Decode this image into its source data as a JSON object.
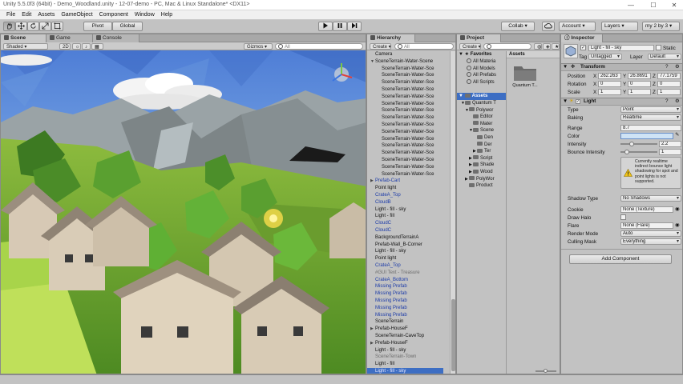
{
  "window": {
    "title": "Unity 5.5.0f3 (64bit) - Demo_Woodland.unity - 12-07-demo - PC, Mac & Linux Standalone* <DX11>",
    "controls": {
      "minimize": "—",
      "maximize": "☐",
      "close": "✕"
    }
  },
  "menu": [
    "File",
    "Edit",
    "Assets",
    "GameObject",
    "Component",
    "Window",
    "Help"
  ],
  "toolbar": {
    "pivot_label": "Pivot",
    "global_label": "Global",
    "collab_label": "Collab ▾",
    "account_label": "Account",
    "layers_label": "Layers",
    "layout_label": "my 2 by 3"
  },
  "scene_panel": {
    "tabs": [
      "Scene",
      "Game",
      "Console"
    ],
    "shading_mode": "Shaded",
    "mode_2d": "2D",
    "gizmos_label": "Gizmos",
    "search_placeholder": "All"
  },
  "hierarchy": {
    "tab_label": "Hierarchy",
    "create_label": "Create",
    "search_placeholder": "All",
    "rows": [
      {
        "text": "Camera",
        "indent": 1,
        "style": "normal"
      },
      {
        "text": "SceneTerrain-Water-Scene",
        "indent": 1,
        "style": "normal",
        "arrow": "▼"
      },
      {
        "text": "SceneTerrain-Water-Sce",
        "indent": 2,
        "style": "normal"
      },
      {
        "text": "SceneTerrain-Water-Sce",
        "indent": 2,
        "style": "normal"
      },
      {
        "text": "SceneTerrain-Water-Sce",
        "indent": 2,
        "style": "normal"
      },
      {
        "text": "SceneTerrain-Water-Sce",
        "indent": 2,
        "style": "normal"
      },
      {
        "text": "SceneTerrain-Water-Sce",
        "indent": 2,
        "style": "normal"
      },
      {
        "text": "SceneTerrain-Water-Sce",
        "indent": 2,
        "style": "normal"
      },
      {
        "text": "SceneTerrain-Water-Sce",
        "indent": 2,
        "style": "normal"
      },
      {
        "text": "SceneTerrain-Water-Sce",
        "indent": 2,
        "style": "normal"
      },
      {
        "text": "SceneTerrain-Water-Sce",
        "indent": 2,
        "style": "normal"
      },
      {
        "text": "SceneTerrain-Water-Sce",
        "indent": 2,
        "style": "normal"
      },
      {
        "text": "SceneTerrain-Water-Sce",
        "indent": 2,
        "style": "normal"
      },
      {
        "text": "SceneTerrain-Water-Sce",
        "indent": 2,
        "style": "normal"
      },
      {
        "text": "SceneTerrain-Water-Sce",
        "indent": 2,
        "style": "normal"
      },
      {
        "text": "SceneTerrain-Water-Sce",
        "indent": 2,
        "style": "normal"
      },
      {
        "text": "SceneTerrain-Water-Sce",
        "indent": 2,
        "style": "normal"
      },
      {
        "text": "SceneTerrain-Water-Sce",
        "indent": 2,
        "style": "normal"
      },
      {
        "text": "Prefab-Cart",
        "indent": 1,
        "style": "blue",
        "arrow": "▶"
      },
      {
        "text": "Point light",
        "indent": 1,
        "style": "normal"
      },
      {
        "text": "CrateA_Top",
        "indent": 1,
        "style": "blue"
      },
      {
        "text": "CloudB",
        "indent": 1,
        "style": "blue"
      },
      {
        "text": "Light - fill - sky",
        "indent": 1,
        "style": "normal"
      },
      {
        "text": "Light - fill",
        "indent": 1,
        "style": "normal"
      },
      {
        "text": "CloudC",
        "indent": 1,
        "style": "blue"
      },
      {
        "text": "CloudC",
        "indent": 1,
        "style": "blue"
      },
      {
        "text": "BackgroundTerrainA",
        "indent": 1,
        "style": "normal"
      },
      {
        "text": "Prefab-Wall_B-Corner",
        "indent": 1,
        "style": "normal"
      },
      {
        "text": "Light - fill - sky",
        "indent": 1,
        "style": "normal"
      },
      {
        "text": "Point light",
        "indent": 1,
        "style": "normal"
      },
      {
        "text": "CrateA_Top",
        "indent": 1,
        "style": "blue"
      },
      {
        "text": "#GUI Text - Treasure",
        "indent": 1,
        "style": "grey"
      },
      {
        "text": "CrateA_Bottom",
        "indent": 1,
        "style": "blue"
      },
      {
        "text": "Missing Prefab",
        "indent": 1,
        "style": "blue"
      },
      {
        "text": "Missing Prefab",
        "indent": 1,
        "style": "blue"
      },
      {
        "text": "Missing Prefab",
        "indent": 1,
        "style": "blue"
      },
      {
        "text": "Missing Prefab",
        "indent": 1,
        "style": "blue"
      },
      {
        "text": "Missing Prefab",
        "indent": 1,
        "style": "blue"
      },
      {
        "text": "SceneTerrain",
        "indent": 1,
        "style": "normal"
      },
      {
        "text": "Prefab-HouseF",
        "indent": 1,
        "style": "normal",
        "arrow": "▶"
      },
      {
        "text": "SceneTerrain-CaveTop",
        "indent": 1,
        "style": "normal"
      },
      {
        "text": "Prefab-HouseF",
        "indent": 1,
        "style": "normal",
        "arrow": "▶"
      },
      {
        "text": "Light - fill - sky",
        "indent": 1,
        "style": "normal"
      },
      {
        "text": "SceneTerrain-Town",
        "indent": 1,
        "style": "grey"
      },
      {
        "text": "Light - fill",
        "indent": 1,
        "style": "normal"
      },
      {
        "text": "Light - fill - sky",
        "indent": 1,
        "style": "sel"
      }
    ]
  },
  "project": {
    "tab_label": "Project",
    "create_label": "Create",
    "favorites_label": "Favorites",
    "favorites": [
      "All Materia",
      "All Models",
      "All Prefabs",
      "All Scripts"
    ],
    "assets_root": "Assets",
    "tree": [
      {
        "text": "Quantum T",
        "indent": 1,
        "arrow": "▼"
      },
      {
        "text": "Polywor",
        "indent": 2,
        "arrow": "▼"
      },
      {
        "text": "Editor",
        "indent": 3
      },
      {
        "text": "Mater",
        "indent": 3
      },
      {
        "text": "Scene",
        "indent": 3,
        "arrow": "▼"
      },
      {
        "text": "Den",
        "indent": 4
      },
      {
        "text": "Der",
        "indent": 4
      },
      {
        "text": "Ter",
        "indent": 4,
        "arrow": "▶"
      },
      {
        "text": "Script",
        "indent": 3,
        "arrow": "▶"
      },
      {
        "text": "Shade",
        "indent": 3,
        "arrow": "▶"
      },
      {
        "text": "Wood",
        "indent": 3,
        "arrow": "▶"
      },
      {
        "text": "PolyWor",
        "indent": 2,
        "arrow": "▶"
      },
      {
        "text": "Product",
        "indent": 2
      }
    ],
    "breadcrumb": "Assets",
    "asset_item": "Quantum T..."
  },
  "inspector": {
    "tab_label": "Inspector",
    "object_name": "Light - fill - sky",
    "static_label": "Static",
    "tag_label": "Tag",
    "tag_value": "Untagged",
    "layer_label": "Layer",
    "layer_value": "Default",
    "transform": {
      "header": "Transform",
      "position_label": "Position",
      "rotation_label": "Rotation",
      "scale_label": "Scale",
      "position": [
        "262.263",
        "26.8691",
        "77.1759"
      ],
      "rotation": [
        "0",
        "0",
        "0"
      ],
      "scale": [
        "1",
        "1",
        "1"
      ]
    },
    "light": {
      "header": "Light",
      "type_label": "Type",
      "type_value": "Point",
      "baking_label": "Baking",
      "baking_value": "Realtime",
      "range_label": "Range",
      "range_value": "8.7",
      "color_label": "Color",
      "color_value": "#cfe3f5",
      "intensity_label": "Intensity",
      "intensity_value": "2.2",
      "intensity_fraction": 0.275,
      "bounce_label": "Bounce Intensity",
      "bounce_value": "1",
      "bounce_fraction": 0.125,
      "warning": "Currently realtime indirect bounce light shadowing for spot and point lights is not supported.",
      "shadow_label": "Shadow Type",
      "shadow_value": "No Shadows",
      "cookie_label": "Cookie",
      "cookie_value": "None (Texture)",
      "halo_label": "Draw Halo",
      "flare_label": "Flare",
      "flare_value": "None (Flare)",
      "render_label": "Render Mode",
      "render_value": "Auto",
      "culling_label": "Culling Mask",
      "culling_value": "Everything"
    },
    "add_component_label": "Add Component"
  },
  "colors": {
    "editor_bg": "#c2c2c2",
    "selection": "#3d6ec3",
    "prefab_text": "#1b3aa8"
  }
}
